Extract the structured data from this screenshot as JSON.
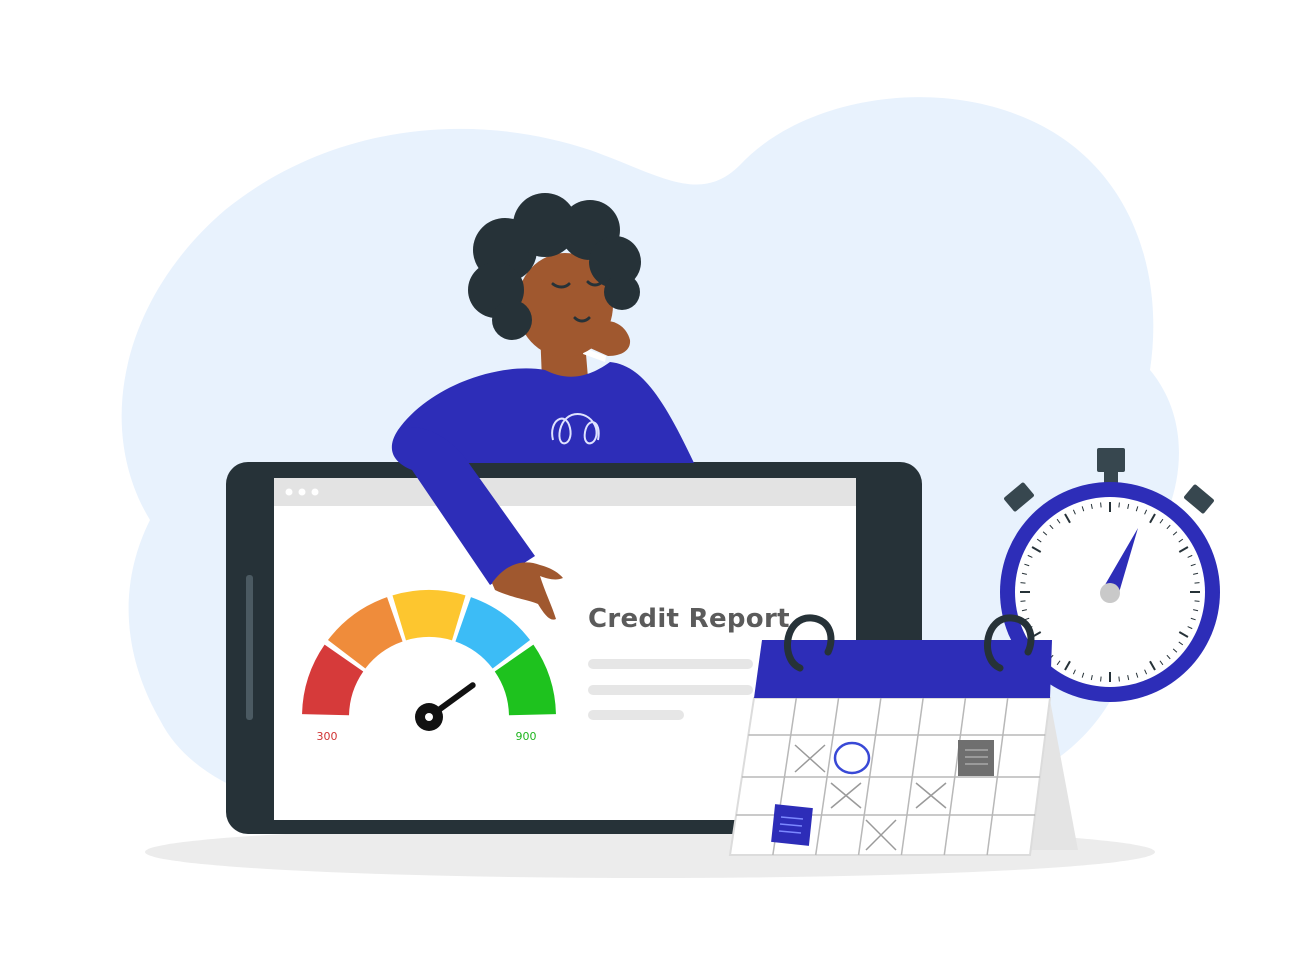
{
  "report": {
    "title": "Credit Report",
    "text_color": "#5b5b5b",
    "line_color": "#e6e6e6"
  },
  "gauge": {
    "min_label": "300",
    "max_label": "900",
    "min_label_color": "#d03434",
    "max_label_color": "#1fb51f",
    "segments": [
      {
        "name": "poor",
        "color": "#d63a3a"
      },
      {
        "name": "fair",
        "color": "#ef8c3b"
      },
      {
        "name": "good",
        "color": "#fdc62f"
      },
      {
        "name": "very-good",
        "color": "#3cbcf6"
      },
      {
        "name": "excellent",
        "color": "#1ec21e"
      }
    ],
    "needle_value": 0.8,
    "needle_color": "#111111"
  },
  "colors": {
    "background_blob": "#e8f2fd",
    "device_frame": "#263238",
    "screen": "#ffffff",
    "browser_bar": "#e3e3e3",
    "shirt": "#2d2db8",
    "shirt_dark": "#1f1f8f",
    "skin": "#a0582f",
    "hair": "#263238",
    "calendar_header": "#2d2db8",
    "calendar_body": "#ffffff",
    "calendar_grid": "#b8b8b8",
    "stopwatch_ring": "#2d2db8",
    "stopwatch_button": "#37474f",
    "shadow": "#ececec"
  },
  "icons": {
    "browser_dots": "three-dots-icon",
    "stopwatch": "stopwatch-icon",
    "calendar": "calendar-icon",
    "gauge": "credit-score-gauge-icon"
  }
}
